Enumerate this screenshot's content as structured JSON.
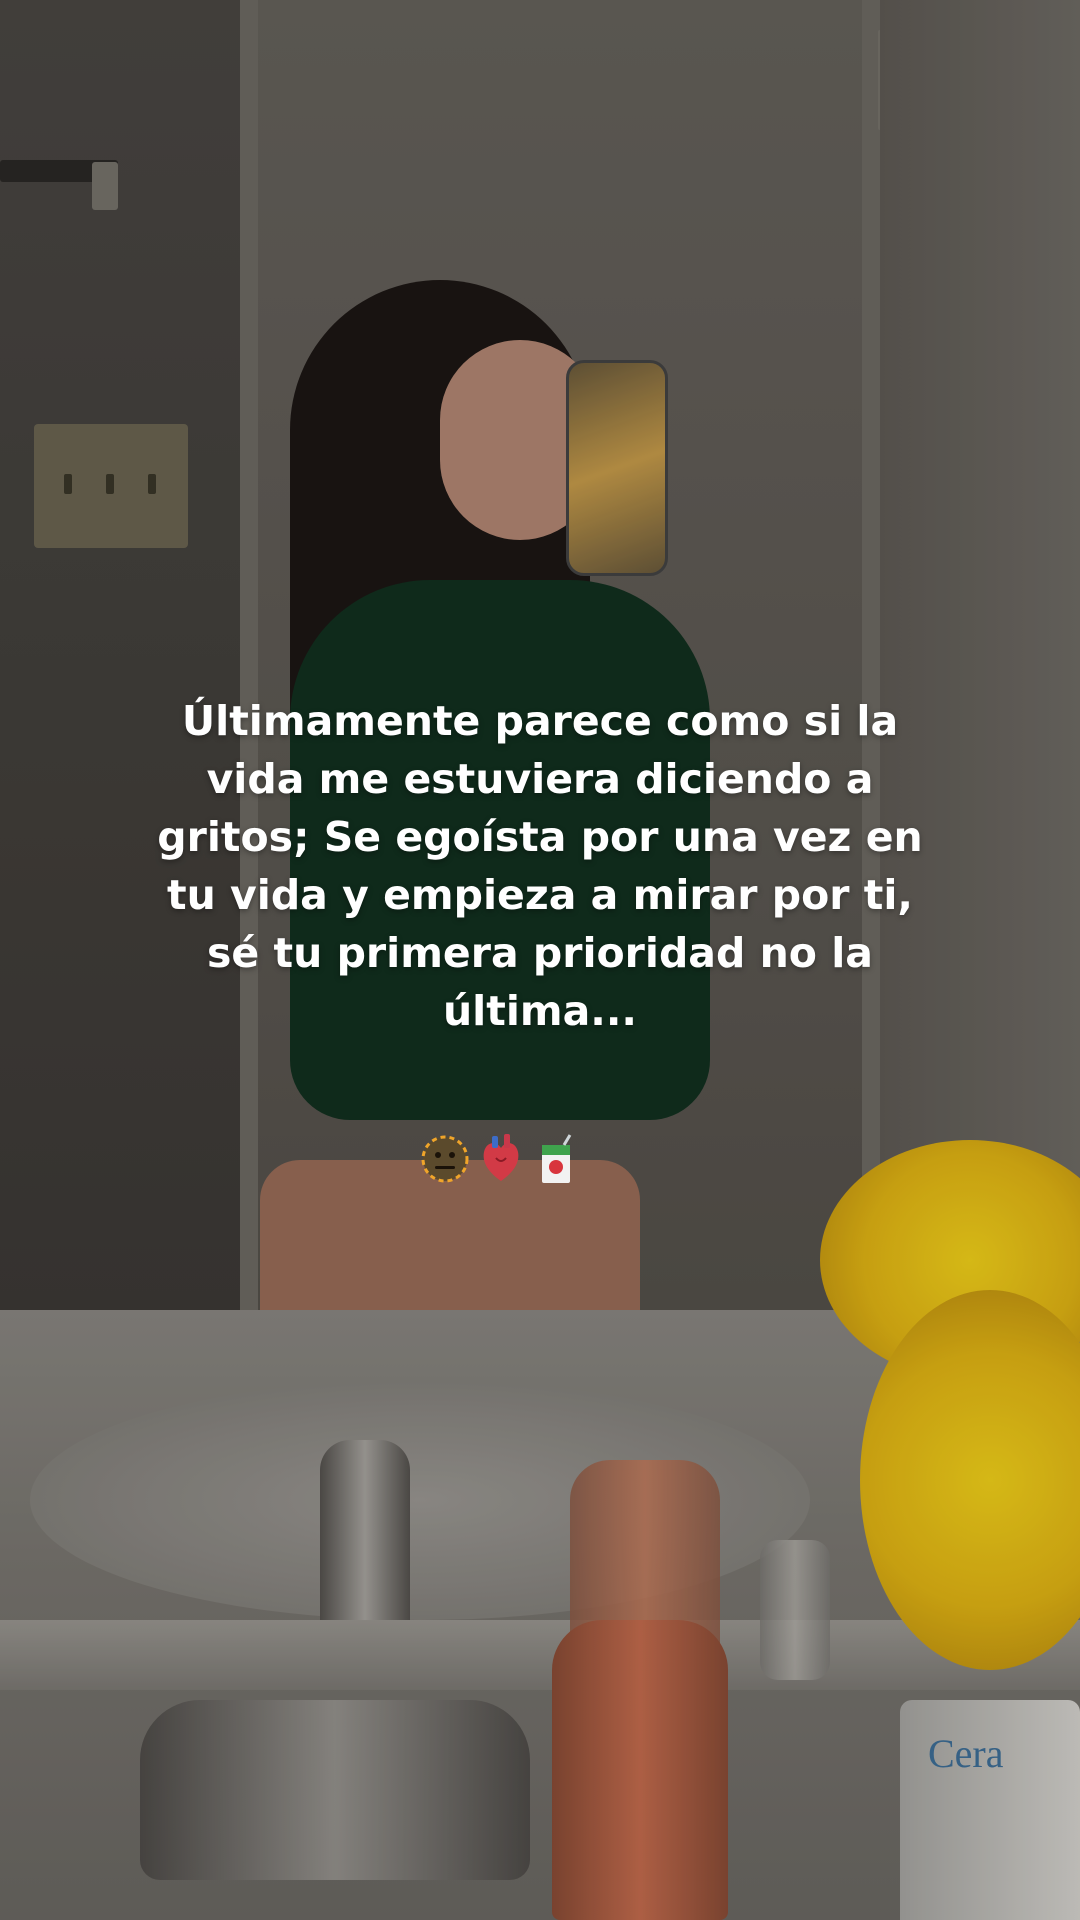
{
  "caption": {
    "text": "Últimamente parece como si la vida me estuviera diciendo a gritos; Se egoísta por una vez en tu vida y empieza a mirar por ti, sé tu primera prioridad no la última..."
  },
  "emojis": [
    {
      "name": "neutral-face-icon",
      "glyph": "😐"
    },
    {
      "name": "anatomical-heart-icon",
      "glyph": "🫀"
    },
    {
      "name": "juice-box-icon",
      "glyph": "🧃"
    }
  ],
  "product": {
    "bottle_label": "Cera"
  }
}
